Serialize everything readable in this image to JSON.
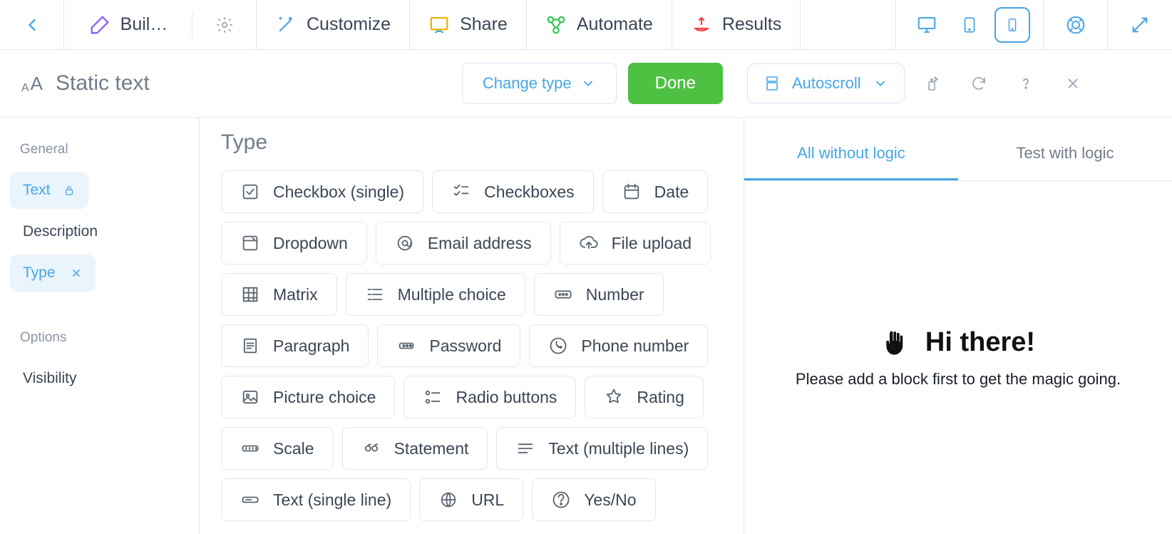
{
  "topnav": {
    "build": "Buil…",
    "customize": "Customize",
    "share": "Share",
    "automate": "Automate",
    "results": "Results"
  },
  "subheader": {
    "title": "Static text",
    "change_type": "Change type",
    "done": "Done"
  },
  "sidebar": {
    "group_general": "General",
    "text": "Text",
    "description": "Description",
    "type": "Type",
    "group_options": "Options",
    "visibility": "Visibility"
  },
  "main": {
    "type_heading": "Type"
  },
  "types": [
    "Checkbox (single)",
    "Checkboxes",
    "Date",
    "Dropdown",
    "Email address",
    "File upload",
    "Matrix",
    "Multiple choice",
    "Number",
    "Paragraph",
    "Password",
    "Phone number",
    "Picture choice",
    "Radio buttons",
    "Rating",
    "Scale",
    "Statement",
    "Text (multiple lines)",
    "Text (single line)",
    "URL",
    "Yes/No"
  ],
  "preview": {
    "autoscroll": "Autoscroll",
    "tab_all": "All without logic",
    "tab_test": "Test with logic",
    "greeting": "Hi there!",
    "empty_msg": "Please add a block first to get the magic going."
  }
}
